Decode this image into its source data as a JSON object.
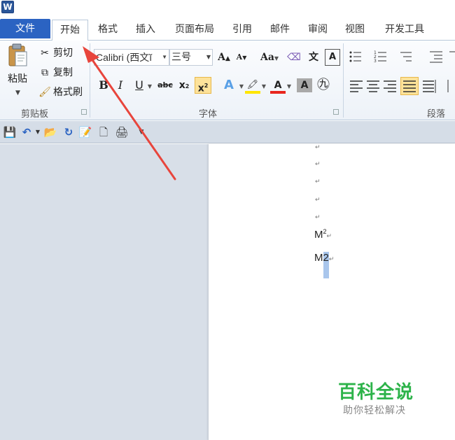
{
  "app": {
    "logo_letter": "W"
  },
  "tabs": [
    {
      "label": "文件",
      "active": false
    },
    {
      "label": "开始",
      "active": true
    },
    {
      "label": "格式",
      "active": false
    },
    {
      "label": "插入",
      "active": false
    },
    {
      "label": "页面布局",
      "active": false
    },
    {
      "label": "引用",
      "active": false
    },
    {
      "label": "邮件",
      "active": false
    },
    {
      "label": "审阅",
      "active": false
    },
    {
      "label": "视图",
      "active": false
    },
    {
      "label": "开发工具",
      "active": false
    }
  ],
  "clipboard": {
    "paste_label": "粘贴",
    "cut_label": "剪切",
    "copy_label": "复制",
    "format_painter_label": "格式刷",
    "group_label": "剪贴板"
  },
  "font": {
    "font_name": "Calibri (西文ĭ",
    "font_size": "三号",
    "change_case_label": "Aa",
    "bold_label": "B",
    "italic_label": "I",
    "underline_label": "U",
    "strike_label": "abc",
    "subscript_label": "x",
    "superscript_label": "x",
    "clear_label": "A",
    "char_border_label": "A",
    "highlight_label": "A",
    "font_color_label": "A",
    "group_label": "字体"
  },
  "paragraph": {
    "group_label": "段落"
  },
  "document": {
    "line1_base": "M",
    "line1_sup": "2",
    "line2_base": "M",
    "line2_selected": "2",
    "para_mark": "↵"
  },
  "watermark": {
    "title": "百科全说",
    "subtitle": "助你轻松解决"
  },
  "colors": {
    "file_tab": "#2b63c2",
    "selection": "#a9c6ec",
    "highlight_button": "#fde29a",
    "annotation_arrow": "#e8453c",
    "watermark_green": "#2db34a"
  }
}
